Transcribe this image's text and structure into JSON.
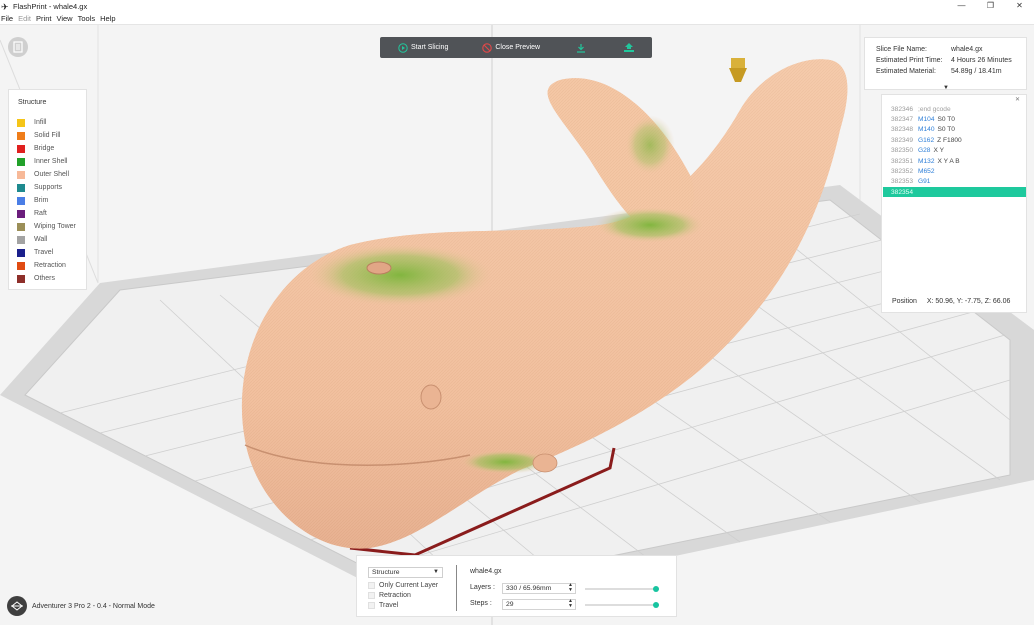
{
  "window": {
    "title": "FlashPrint - whale4.gx",
    "controls": [
      "—",
      "❐",
      "✕"
    ]
  },
  "menu": [
    {
      "label": "File",
      "enabled": true
    },
    {
      "label": "Edit",
      "enabled": false
    },
    {
      "label": "Print",
      "enabled": true
    },
    {
      "label": "View",
      "enabled": true
    },
    {
      "label": "Tools",
      "enabled": true
    },
    {
      "label": "Help",
      "enabled": true
    }
  ],
  "toolbar": {
    "start_slicing": "Start Slicing",
    "close_preview": "Close Preview",
    "export_icon": "export-icon",
    "upload_icon": "upload-icon"
  },
  "legend": {
    "title": "Structure",
    "items": [
      {
        "label": "Infill",
        "color": "#f5c518"
      },
      {
        "label": "Solid Fill",
        "color": "#ef7d1a"
      },
      {
        "label": "Bridge",
        "color": "#e0201f"
      },
      {
        "label": "Inner Shell",
        "color": "#22a12a"
      },
      {
        "label": "Outer Shell",
        "color": "#f7b998"
      },
      {
        "label": "Supports",
        "color": "#1e8a8f"
      },
      {
        "label": "Brim",
        "color": "#4a7ee6"
      },
      {
        "label": "Raft",
        "color": "#6b1d7c"
      },
      {
        "label": "Wiping Tower",
        "color": "#9b8f58"
      },
      {
        "label": "Wall",
        "color": "#a3a3a3"
      },
      {
        "label": "Travel",
        "color": "#1a1f8c"
      },
      {
        "label": "Retraction",
        "color": "#e04b12"
      },
      {
        "label": "Others",
        "color": "#8e2f2a"
      }
    ]
  },
  "info": {
    "rows": [
      {
        "key": "Slice File Name:",
        "value": "whale4.gx"
      },
      {
        "key": "Estimated Print Time:",
        "value": "4 Hours 26 Minutes"
      },
      {
        "key": "Estimated Material:",
        "value": "54.89g / 18.41m"
      }
    ]
  },
  "gcode": {
    "lines": [
      {
        "num": "382346",
        "cmd": ";end gcode",
        "args": "",
        "comment": true
      },
      {
        "num": "382347",
        "cmd": "M104",
        "args": "S0 T0"
      },
      {
        "num": "382348",
        "cmd": "M140",
        "args": "S0 T0"
      },
      {
        "num": "382349",
        "cmd": "G162",
        "args": "Z F1800"
      },
      {
        "num": "382350",
        "cmd": "G28",
        "args": "X Y"
      },
      {
        "num": "382351",
        "cmd": "M132",
        "args": "X Y A B"
      },
      {
        "num": "382352",
        "cmd": "M652",
        "args": ""
      },
      {
        "num": "382353",
        "cmd": "G91",
        "args": ""
      },
      {
        "num": "382354",
        "cmd": "",
        "args": "",
        "selected": true
      }
    ],
    "position_label": "Position",
    "position_value": "X: 50.96, Y: -7.75, Z: 66.06"
  },
  "controls": {
    "view_select": "Structure",
    "checkboxes": [
      "Only Current Layer",
      "Retraction",
      "Travel"
    ],
    "file_name": "whale4.gx",
    "layers_label": "Layers :",
    "layers_value": "330 / 65.96mm",
    "layers_fraction": 1.0,
    "steps_label": "Steps :",
    "steps_value": "29",
    "steps_fraction": 1.0
  },
  "printer": {
    "status": "Adventurer 3 Pro 2 - 0.4 - Normal Mode"
  }
}
